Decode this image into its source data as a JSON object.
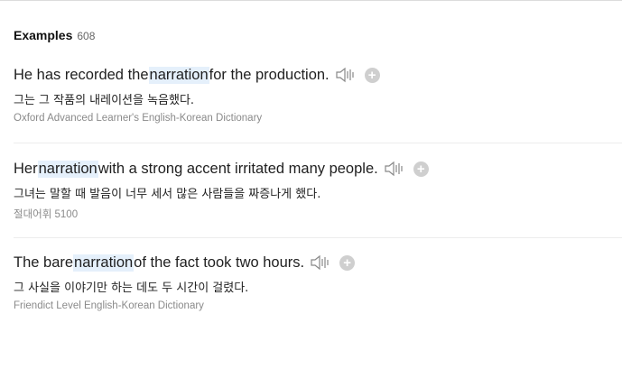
{
  "section": {
    "title": "Examples",
    "count": "608"
  },
  "examples": [
    {
      "en_before": "He has recorded the ",
      "en_highlight": "narration",
      "en_after": " for the production.",
      "ko": "그는 그 작품의 내레이션을 녹음했다.",
      "source": "Oxford Advanced Learner's English-Korean Dictionary"
    },
    {
      "en_before": "Her ",
      "en_highlight": "narration",
      "en_after": " with a strong accent irritated many people.",
      "ko": "그녀는 말할 때 발음이 너무 세서 많은 사람들을 짜증나게 했다.",
      "source": "절대어휘 5100"
    },
    {
      "en_before": "The bare ",
      "en_highlight": "narration",
      "en_after": " of the fact took two hours.",
      "ko": "그 사실을 이야기만 하는 데도 두 시간이 걸렸다.",
      "source": "Friendict Level English-Korean Dictionary"
    }
  ],
  "icons": {
    "audio": "speaker-icon",
    "add": "plus-icon"
  },
  "colors": {
    "highlight": "#e5f0fb",
    "source_text": "#8a8a8a",
    "add_button": "#cfcfcf"
  }
}
